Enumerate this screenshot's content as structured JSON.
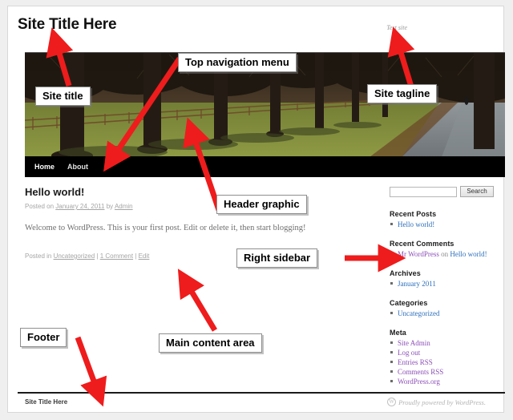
{
  "site": {
    "title": "Site Title Here",
    "tagline": "Test site"
  },
  "nav": {
    "items": [
      {
        "label": "Home",
        "current": true
      },
      {
        "label": "About",
        "current": false
      }
    ]
  },
  "post": {
    "title": "Hello world!",
    "meta_prefix": "Posted on ",
    "date": "January 24, 2011",
    "meta_by": " by ",
    "author": "Admin",
    "body": "Welcome to WordPress. This is your first post. Edit or delete it, then start blogging!",
    "footer_prefix": "Posted in ",
    "category": "Uncategorized",
    "sep1": " | ",
    "comments": "1 Comment",
    "sep2": " | ",
    "edit": "Edit"
  },
  "sidebar": {
    "search": {
      "value": "",
      "placeholder": "",
      "button_label": "Search"
    },
    "widgets": [
      {
        "title": "Recent Posts",
        "items": [
          {
            "text": "Hello world!",
            "style": "link"
          }
        ]
      },
      {
        "title": "Recent Comments",
        "items": [
          {
            "author": "Mr WordPress",
            "connector": " on ",
            "target": "Hello world!",
            "style": "comment"
          }
        ]
      },
      {
        "title": "Archives",
        "items": [
          {
            "text": "January 2011",
            "style": "link"
          }
        ]
      },
      {
        "title": "Categories",
        "items": [
          {
            "text": "Uncategorized",
            "style": "link"
          }
        ]
      },
      {
        "title": "Meta",
        "items": [
          {
            "text": "Site Admin",
            "style": "visited"
          },
          {
            "text": "Log out",
            "style": "visited"
          },
          {
            "text": "Entries RSS",
            "style": "visited",
            "abbr": "RSS"
          },
          {
            "text": "Comments RSS",
            "style": "visited",
            "abbr": "RSS"
          },
          {
            "text": "WordPress.org",
            "style": "visited"
          }
        ]
      }
    ]
  },
  "footer": {
    "site_title": "Site Title Here",
    "credit": "Proudly powered by WordPress.",
    "logo_glyph": "W"
  },
  "annotations": [
    {
      "id": "site-title",
      "label": "Site title"
    },
    {
      "id": "top-nav",
      "label": "Top navigation menu"
    },
    {
      "id": "site-tagline",
      "label": "Site tagline"
    },
    {
      "id": "header-graphic",
      "label": "Header graphic"
    },
    {
      "id": "right-sidebar",
      "label": "Right sidebar"
    },
    {
      "id": "main-content",
      "label": "Main content area"
    },
    {
      "id": "footer",
      "label": "Footer"
    }
  ],
  "colors": {
    "arrow": "#ee1c1c",
    "link": "#2c6fbb",
    "visited_link": "#8d50b7",
    "nav_bar": "#000000",
    "page_bg": "#efefef"
  }
}
